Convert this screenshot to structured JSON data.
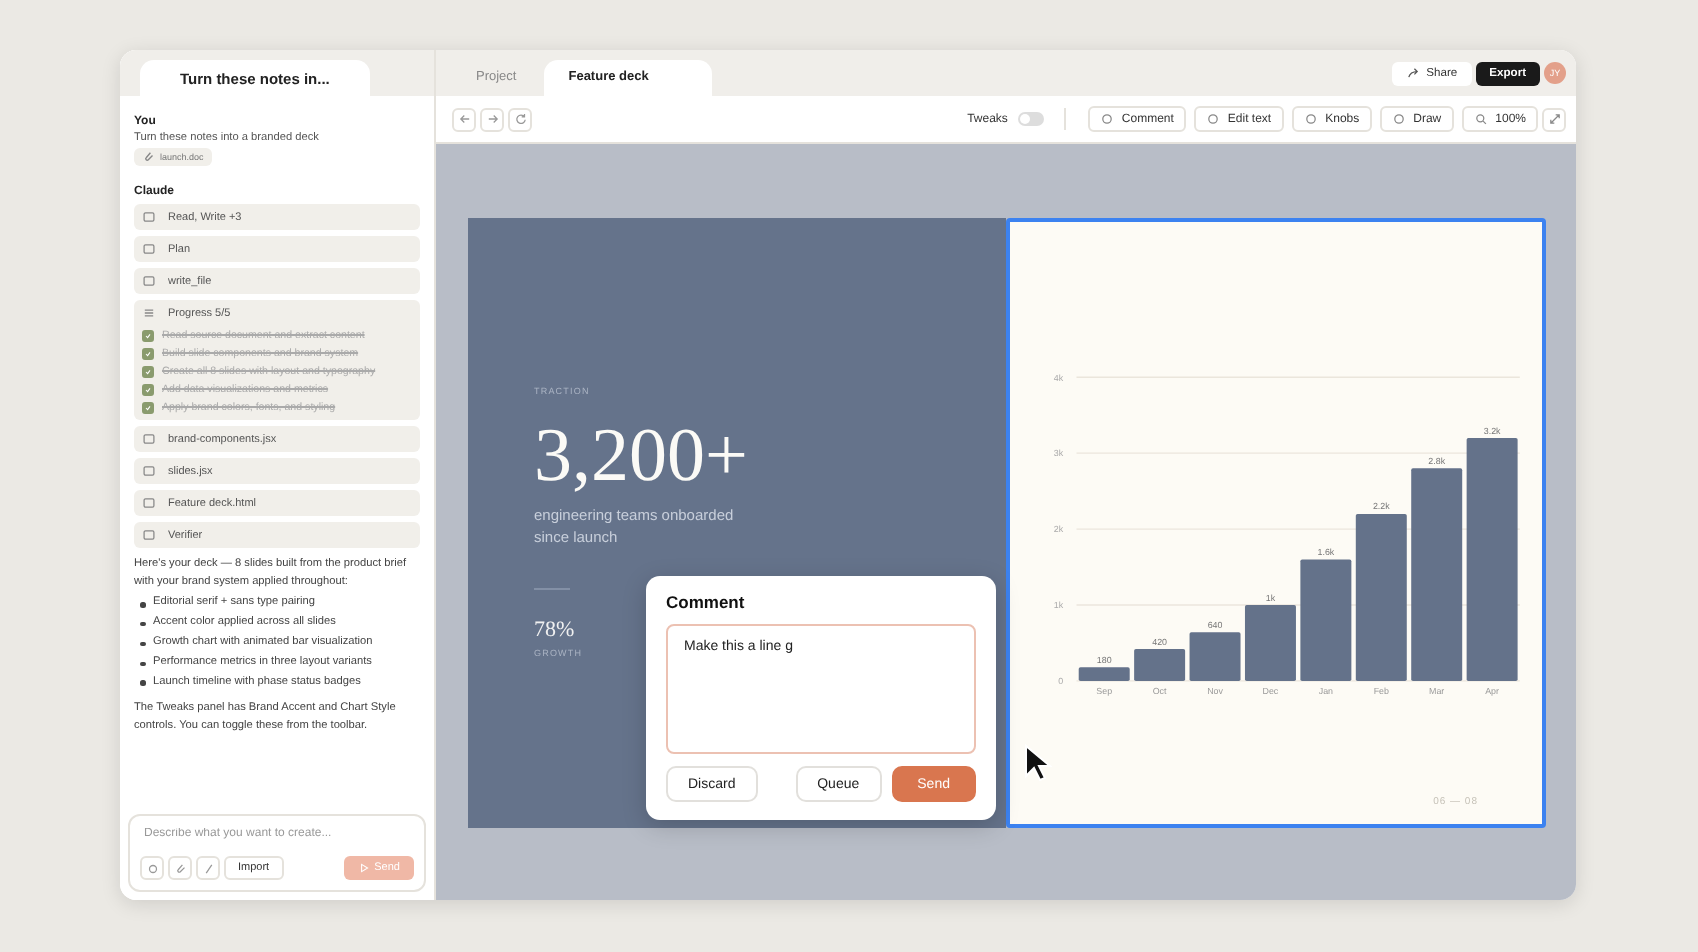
{
  "chat": {
    "tab_title": "Turn these notes in...",
    "user": {
      "label": "You",
      "message": "Turn these notes into a branded deck",
      "attachment": "launch.doc"
    },
    "assistant_label": "Claude",
    "steps": [
      {
        "kind": "tool",
        "label": "Read, Write +3"
      },
      {
        "kind": "tool",
        "label": "Plan"
      },
      {
        "kind": "tool",
        "label": "write_file"
      },
      {
        "kind": "progress",
        "label": "Progress 5/5",
        "tasks": [
          {
            "label": "Read source document and extract content",
            "checked": true
          },
          {
            "label": "Build slide components and brand system",
            "checked": true
          },
          {
            "label": "Create all 8 slides with layout and typography",
            "checked": true
          },
          {
            "label": "Add data visualizations and metrics",
            "checked": true
          },
          {
            "label": "Apply brand colors, fonts, and styling",
            "checked": true
          }
        ]
      },
      {
        "kind": "tool",
        "label": "brand-components.jsx"
      },
      {
        "kind": "tool",
        "label": "slides.jsx"
      },
      {
        "kind": "tool",
        "label": "Feature deck.html"
      },
      {
        "kind": "tool",
        "label": "Verifier"
      }
    ],
    "reply_intro": "Here's your deck — 8 slides built from the product brief with your brand system applied throughout:",
    "reply_bullets": [
      "Editorial serif + sans type pairing",
      "Accent color applied across all slides",
      "Growth chart with animated bar visualization",
      "Performance metrics in three layout variants",
      "Launch timeline with phase status badges"
    ],
    "reply_outro": "The Tweaks panel has Brand Accent and Chart Style controls. You can toggle these from the toolbar.",
    "input": {
      "placeholder": "Describe what you want to create...",
      "import_label": "Import",
      "send_label": "Send",
      "send_disabled": true
    }
  },
  "tabs": [
    {
      "label": "Project",
      "selected": false
    },
    {
      "label": "Feature deck",
      "selected": true
    }
  ],
  "top_actions": {
    "share": "Share",
    "export": "Export",
    "avatar": "JY"
  },
  "toolbar": {
    "tweaks_label": "Tweaks",
    "tweaks_on": false,
    "tools": [
      "Comment",
      "Edit text",
      "Knobs",
      "Draw"
    ],
    "zoom": "100%"
  },
  "slide": {
    "eyebrow": "TRACTION",
    "headline": "3,200+",
    "subhead": "engineering teams onboarded since launch",
    "metric": "78%",
    "metric_label": "GROWTH",
    "page": "06 — 08",
    "chart_data": {
      "type": "bar",
      "categories": [
        "Sep",
        "Oct",
        "Nov",
        "Dec",
        "Jan",
        "Feb",
        "Mar",
        "Apr"
      ],
      "grid": true,
      "series": [
        {
          "color": "#64728a",
          "values": [
            180,
            420,
            640,
            1000,
            1600,
            2200,
            2800,
            3200
          ]
        }
      ],
      "ylim": [
        0,
        4000
      ],
      "yticks": [
        {
          "value": 0,
          "label": "0"
        },
        {
          "value": 1000,
          "label": "1k"
        },
        {
          "value": 2000,
          "label": "2k"
        },
        {
          "value": 3000,
          "label": "3k"
        },
        {
          "value": 4000,
          "label": "4k"
        }
      ],
      "value_labels": [
        "180",
        "420",
        "640",
        "1k",
        "1.6k",
        "2.2k",
        "2.8k",
        "3.2k"
      ]
    }
  },
  "comment": {
    "title": "Comment",
    "value": "Make this a line g",
    "discard": "Discard",
    "queue": "Queue",
    "send": "Send"
  }
}
